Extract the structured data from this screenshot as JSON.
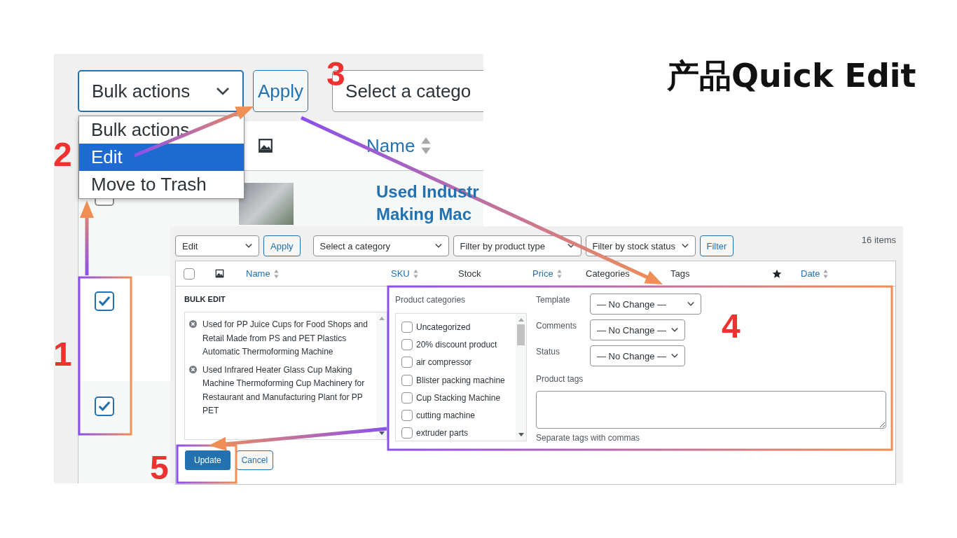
{
  "title": "产品Quick Edit",
  "steps": [
    {
      "label": "1"
    },
    {
      "label": "2"
    },
    {
      "label": "3"
    },
    {
      "label": "4"
    },
    {
      "label": "5"
    }
  ],
  "list_screen": {
    "bulk_select": "Bulk actions",
    "apply_button": "Apply",
    "category_select": "Select a catego",
    "bulk_menu": [
      {
        "label": "Bulk actions",
        "selected": false
      },
      {
        "label": "Edit",
        "selected": true
      },
      {
        "label": "Move to Trash",
        "selected": false
      }
    ],
    "name_column": "Name",
    "rows": [
      {
        "checked": false,
        "title_lines": [
          "Used Industr",
          "Making Mac"
        ]
      },
      {
        "checked": true
      },
      {
        "checked": true
      }
    ]
  },
  "bulk_edit_screen": {
    "action_select": "Edit",
    "apply_button": "Apply",
    "category_select": "Select a category",
    "type_select": "Filter by product type",
    "stock_select": "Filter by stock status",
    "filter_button": "Filter",
    "count": "16 items",
    "columns": [
      {
        "kind": "checkbox",
        "checked": false
      },
      {
        "kind": "image"
      },
      {
        "kind": "text",
        "label": "Name",
        "sortable": true
      },
      {
        "kind": "text",
        "label": "SKU",
        "sortable": true
      },
      {
        "kind": "text",
        "label": "Stock",
        "sortable": false
      },
      {
        "kind": "text",
        "label": "Price",
        "sortable": true
      },
      {
        "kind": "text",
        "label": "Categories",
        "sortable": false
      },
      {
        "kind": "text",
        "label": "Tags",
        "sortable": false
      },
      {
        "kind": "star"
      },
      {
        "kind": "text",
        "label": "Date",
        "sortable": true
      }
    ],
    "heading": "BULK EDIT",
    "items": [
      "Used for PP Juice Cups for Food Shops and Retail Made from PS and PET Plastics Automatic Thermoforming Machine",
      "Used Infrared Heater Glass Cup Making Machine Thermoforming Cup Machinery for Restaurant and Manufacturing Plant for PP PET"
    ],
    "categories_label": "Product categories",
    "categories": [
      {
        "label": "Uncategorized",
        "checked": false
      },
      {
        "label": "20% discount product",
        "checked": false
      },
      {
        "label": "air compressor",
        "checked": false
      },
      {
        "label": "Blister packing machine",
        "checked": false
      },
      {
        "label": "Cup Stacking Machine",
        "checked": false
      },
      {
        "label": "cutting machine",
        "checked": false
      },
      {
        "label": "extruder parts",
        "checked": false
      }
    ],
    "fields": [
      {
        "label": "Template",
        "value": "— No Change —"
      },
      {
        "label": "Comments",
        "value": "— No Change —"
      },
      {
        "label": "Status",
        "value": "— No Change —"
      }
    ],
    "tags_label": "Product tags",
    "tags_hint": "Separate tags with commas",
    "update_button": "Update",
    "cancel_button": "Cancel"
  }
}
